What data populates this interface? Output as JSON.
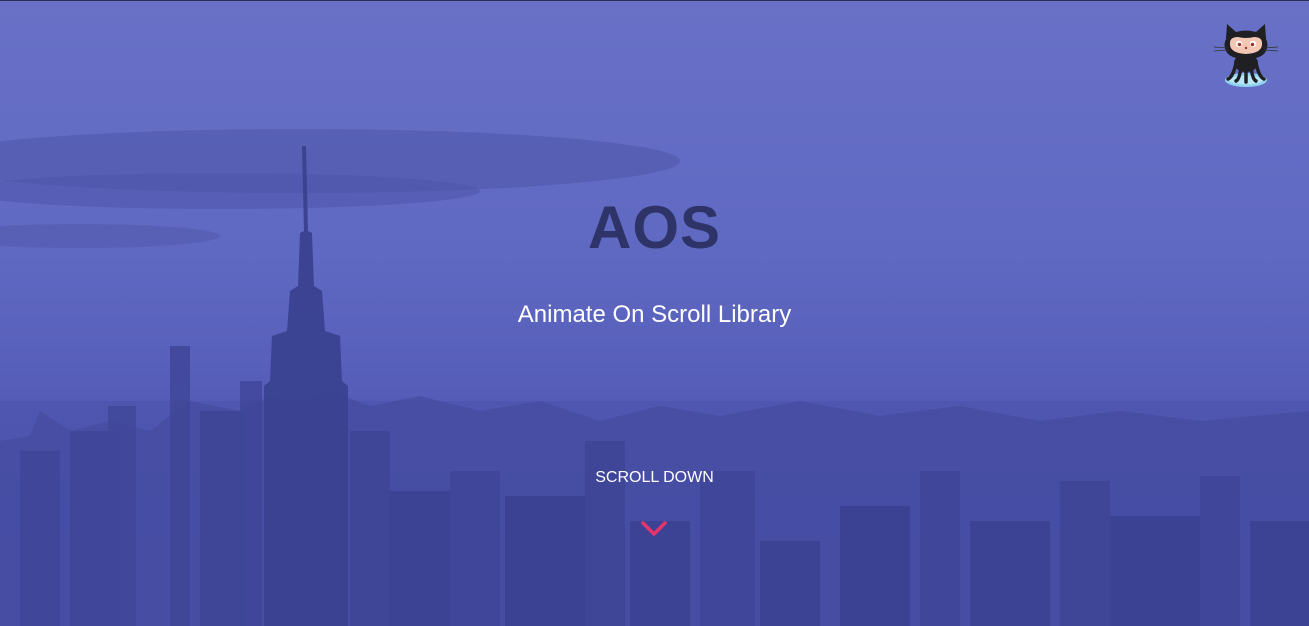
{
  "hero": {
    "title": "AOS",
    "subtitle": "Animate On Scroll Library",
    "scroll_label": "SCROLL DOWN"
  },
  "icons": {
    "github": "octocat-icon",
    "scroll": "chevron-down-icon"
  },
  "colors": {
    "overlay": "#5a63bd",
    "title": "#2e3468",
    "text": "#ffffff",
    "accent": "#e8336d"
  }
}
